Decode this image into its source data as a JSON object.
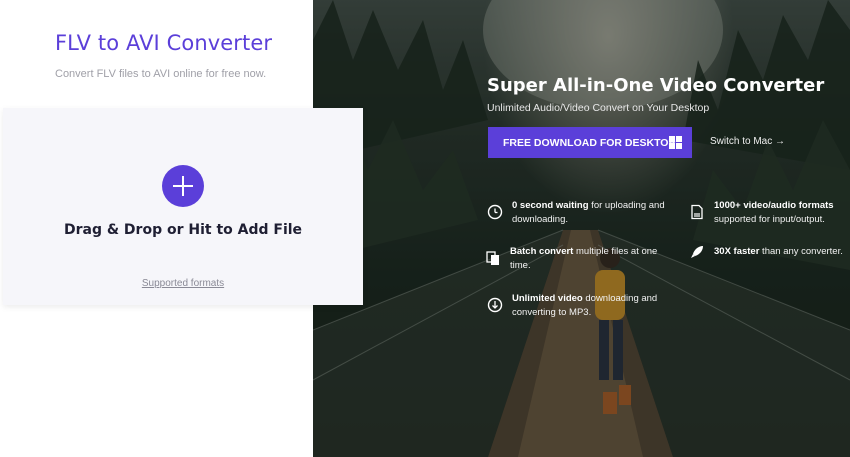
{
  "left": {
    "title": "FLV to AVI Converter",
    "subtitle": "Convert FLV files to AVI online for free now.",
    "drop_label": "Drag & Drop or Hit to Add File",
    "formats_link": "Supported formats"
  },
  "hero": {
    "title": "Super All-in-One Video Converter",
    "subtitle": "Unlimited Audio/Video Convert on Your Desktop",
    "download_label": "FREE DOWNLOAD FOR DESKTOP",
    "switch_label": "Switch to Mac →",
    "features": [
      {
        "icon": "clock-icon",
        "bold": "0 second waiting",
        "rest": " for uploading and downloading."
      },
      {
        "icon": "file-icon",
        "bold": "1000+ video/audio formats",
        "rest": " supported for input/output."
      },
      {
        "icon": "copy-icon",
        "bold": "Batch convert",
        "rest": " multiple files at one time."
      },
      {
        "icon": "rocket-icon",
        "bold": "30X faster",
        "rest": " than any converter."
      },
      {
        "icon": "download-icon",
        "bold": "Unlimited video",
        "rest": " downloading and converting to MP3."
      }
    ]
  },
  "colors": {
    "accent": "#5b3fd9",
    "drop_bg": "#f6f6fa"
  }
}
